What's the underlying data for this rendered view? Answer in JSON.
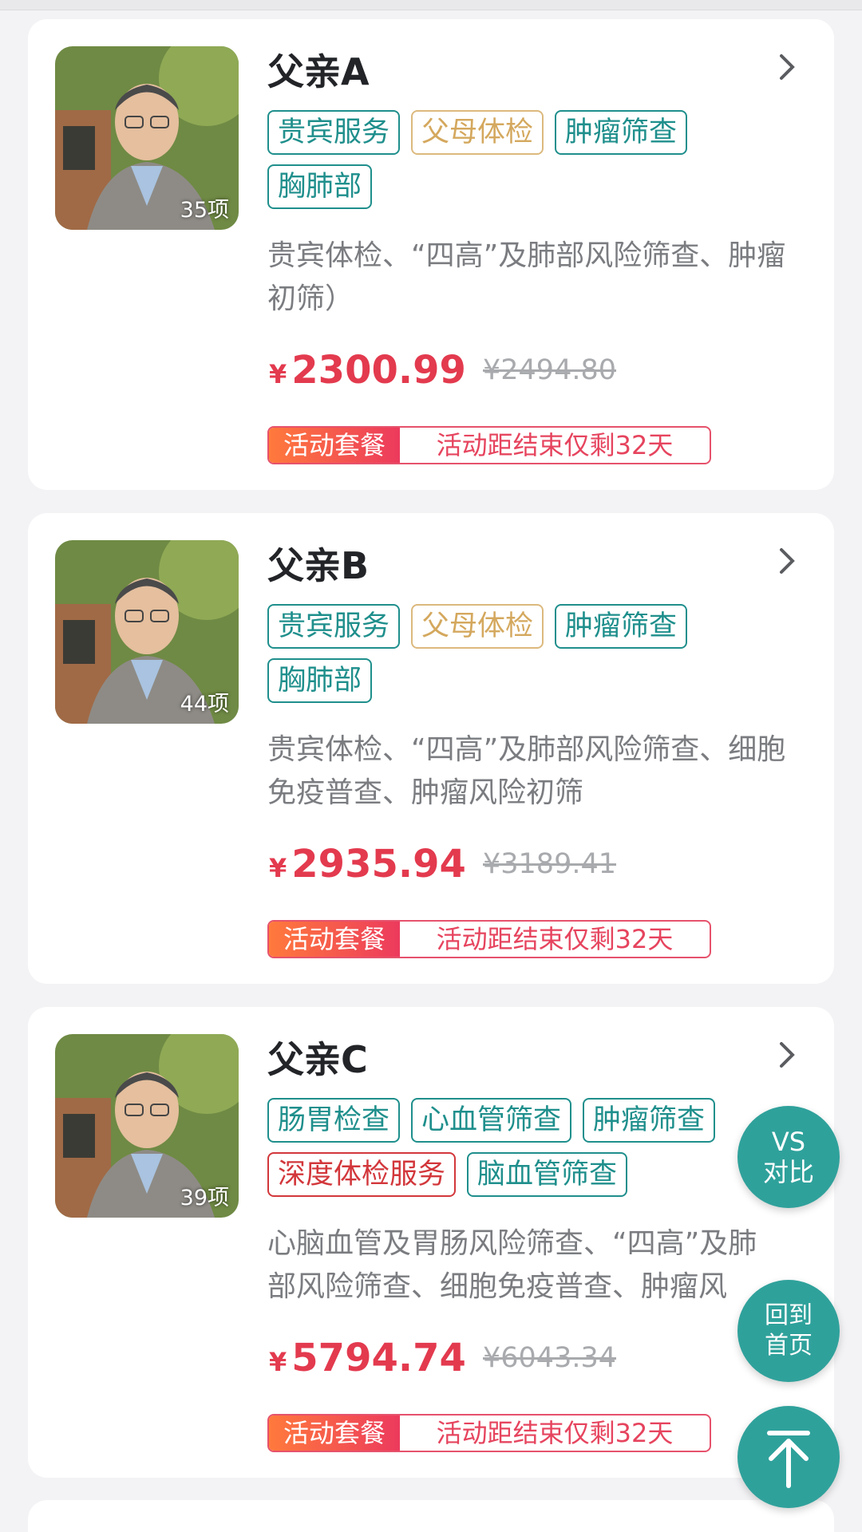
{
  "cards": [
    {
      "title": "父亲A",
      "count": "35项",
      "tags": [
        {
          "label": "贵宾服务",
          "style": "teal"
        },
        {
          "label": "父母体检",
          "style": "gold"
        },
        {
          "label": "肿瘤筛查",
          "style": "teal"
        },
        {
          "label": "胸肺部",
          "style": "teal"
        }
      ],
      "description": "贵宾体检、“四高”及肺部风险筛查、肿瘤初筛）",
      "price_symbol": "¥",
      "price": "2300.99",
      "original_price": "¥2494.80",
      "promo_label": "活动套餐",
      "promo_text": "活动距结束仅剩32天"
    },
    {
      "title": "父亲B",
      "count": "44项",
      "tags": [
        {
          "label": "贵宾服务",
          "style": "teal"
        },
        {
          "label": "父母体检",
          "style": "gold"
        },
        {
          "label": "肿瘤筛查",
          "style": "teal"
        },
        {
          "label": "胸肺部",
          "style": "teal"
        }
      ],
      "description": "贵宾体检、“四高”及肺部风险筛查、细胞免疫普查、肿瘤风险初筛",
      "price_symbol": "¥",
      "price": "2935.94",
      "original_price": "¥3189.41",
      "promo_label": "活动套餐",
      "promo_text": "活动距结束仅剩32天"
    },
    {
      "title": "父亲C",
      "count": "39项",
      "tags": [
        {
          "label": "肠胃检查",
          "style": "teal"
        },
        {
          "label": "心血管筛查",
          "style": "teal"
        },
        {
          "label": "肿瘤筛查",
          "style": "teal"
        },
        {
          "label": "深度体检服务",
          "style": "red"
        },
        {
          "label": "脑血管筛查",
          "style": "teal"
        }
      ],
      "description": "心脑血管及胃肠风险筛查、“四高”及肺部风险筛查、细胞免疫普查、肿瘤风",
      "price_symbol": "¥",
      "price": "5794.74",
      "original_price": "¥6043.34",
      "promo_label": "活动套餐",
      "promo_text": "活动距结束仅剩32天"
    }
  ],
  "fab": {
    "vs_line1": "VS",
    "vs_line2": "对比",
    "home_line1": "回到",
    "home_line2": "首页",
    "top_icon": "arrow-up-to-top-icon"
  },
  "colors": {
    "teal": "#1f8f8c",
    "gold": "#d4a85e",
    "red": "#d2373b",
    "price": "#e33a4e",
    "fab": "#2fa19b"
  }
}
